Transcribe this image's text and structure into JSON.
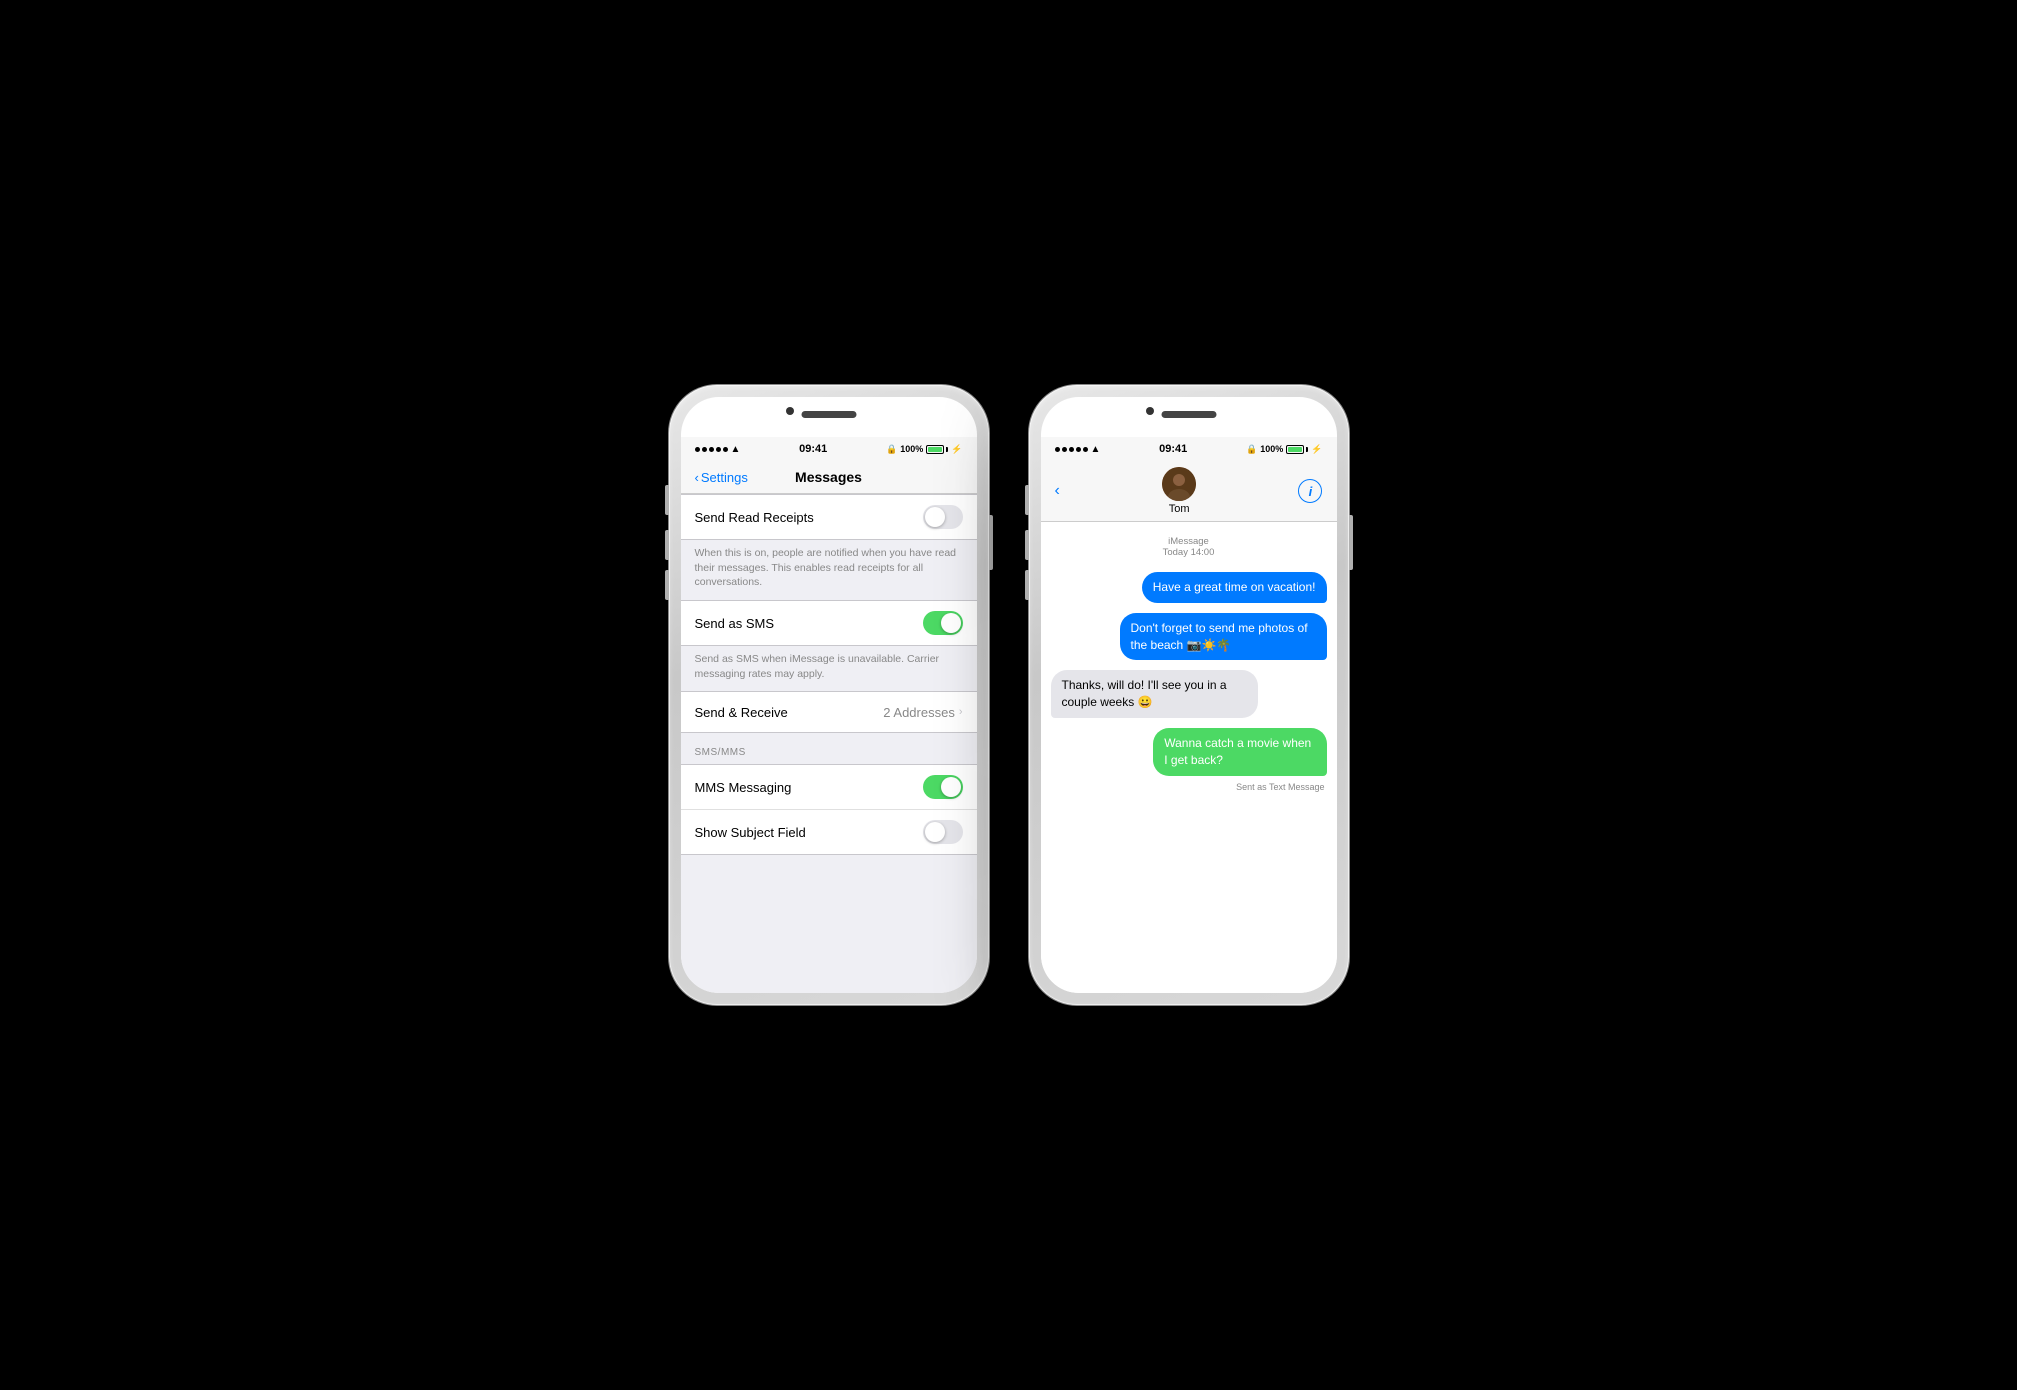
{
  "scene": {
    "background": "#000000"
  },
  "phone1": {
    "hardware": {
      "camera_label": "camera",
      "speaker_label": "speaker"
    },
    "status_bar": {
      "time": "09:41",
      "signal": "•••••",
      "wifi": "WiFi",
      "lock": "🔒",
      "battery_percent": "100%",
      "battery_bolt": "⚡"
    },
    "header": {
      "back_label": "Settings",
      "title": "Messages"
    },
    "settings": [
      {
        "group": "read_receipts",
        "rows": [
          {
            "label": "Send Read Receipts",
            "toggle": "off"
          }
        ],
        "description": "When this is on, people are notified when you have read their messages. This enables read receipts for all conversations."
      },
      {
        "group": "sms",
        "rows": [
          {
            "label": "Send as SMS",
            "toggle": "on"
          }
        ],
        "description": "Send as SMS when iMessage is unavailable. Carrier messaging rates may apply."
      },
      {
        "group": "send_receive",
        "rows": [
          {
            "label": "Send & Receive",
            "value": "2 Addresses",
            "has_chevron": true
          }
        ]
      },
      {
        "group": "smsmms",
        "section_label": "SMS/MMS",
        "rows": [
          {
            "label": "MMS Messaging",
            "toggle": "on"
          },
          {
            "label": "Show Subject Field",
            "toggle": "off"
          }
        ]
      }
    ]
  },
  "phone2": {
    "hardware": {
      "camera_label": "camera",
      "speaker_label": "speaker"
    },
    "status_bar": {
      "time": "09:41",
      "signal": "•••••",
      "wifi": "WiFi",
      "lock": "🔒",
      "battery_percent": "100%",
      "battery_bolt": "⚡"
    },
    "header": {
      "back_icon": "‹",
      "contact_name": "Tom",
      "contact_avatar": "👤",
      "info_label": "i"
    },
    "messages": {
      "timestamp": "iMessage\nToday 14:00",
      "bubbles": [
        {
          "type": "sent-blue",
          "text": "Have a great time on vacation!"
        },
        {
          "type": "sent-blue",
          "text": "Don't forget to send me photos of the beach 📷☀️🌴"
        },
        {
          "type": "received",
          "text": "Thanks, will do! I'll see you in a couple weeks 😀"
        },
        {
          "type": "sent-green",
          "text": "Wanna catch a movie when I get back?",
          "sub_label": "Sent as Text Message"
        }
      ]
    }
  }
}
